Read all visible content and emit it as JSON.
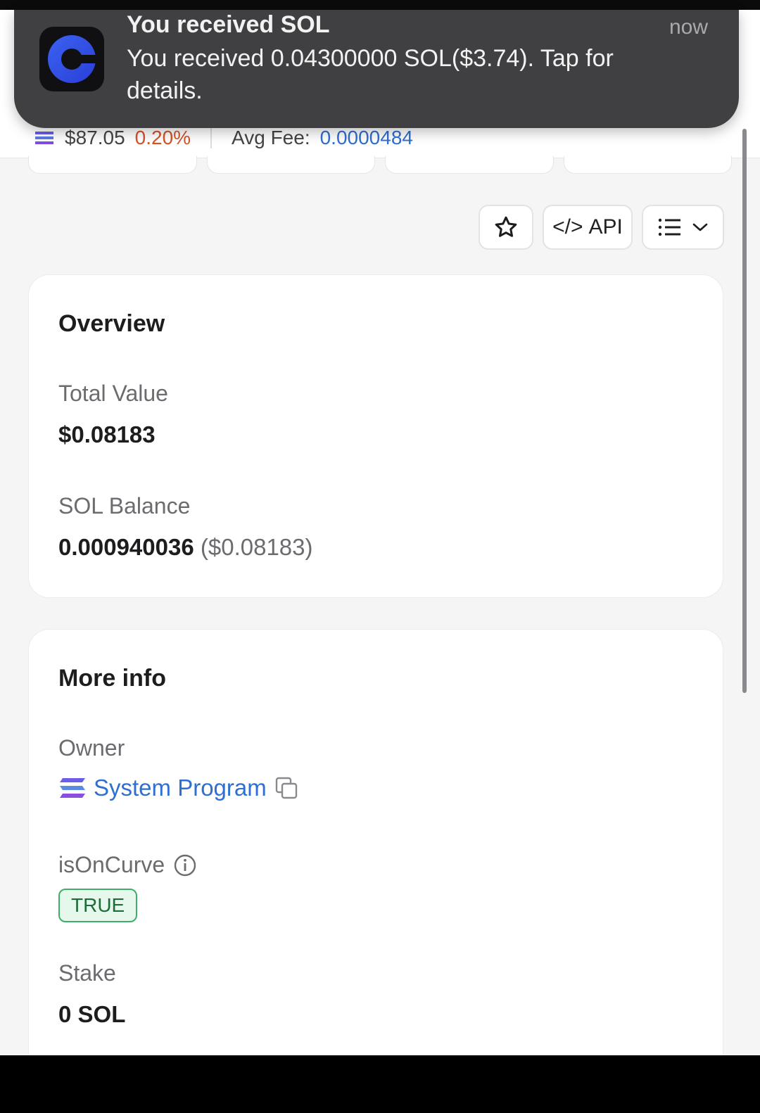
{
  "background_header": {
    "price": "$87.05",
    "price_change": "0.20%",
    "avg_fee_label": "Avg Fee:",
    "avg_fee_value": "0.0000484"
  },
  "notification": {
    "app_icon": "c-logo-icon",
    "title": "You received SOL",
    "time": "now",
    "body": "You received 0.04300000 SOL($3.74). Tap for details."
  },
  "toolbar": {
    "favorite_icon": "star-icon",
    "api_label": "API",
    "api_icon": "code-icon",
    "menu_icon": "list-icon"
  },
  "overview": {
    "title": "Overview",
    "total_value_label": "Total Value",
    "total_value": "$0.08183",
    "sol_balance_label": "SOL Balance",
    "sol_balance": "0.000940036",
    "sol_balance_usd": "($0.08183)"
  },
  "more_info": {
    "title": "More info",
    "owner_label": "Owner",
    "owner_value": "System Program",
    "is_on_curve_label": "isOnCurve",
    "is_on_curve_value": "TRUE",
    "stake_label": "Stake",
    "stake_value": "0 SOL"
  },
  "colors": {
    "link_blue": "#2f6fd1",
    "price_down": "#d4542b",
    "badge_green": "#3fae6b",
    "notification_bg": "#3a3a3c"
  }
}
